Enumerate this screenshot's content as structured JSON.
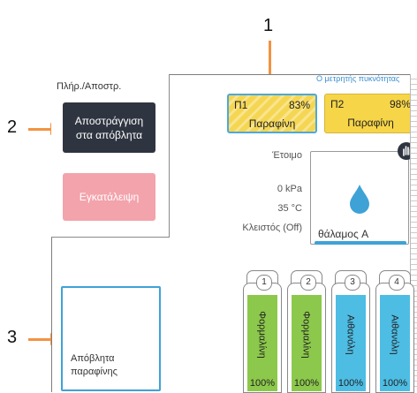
{
  "callouts": {
    "c1": "1",
    "c2": "2",
    "c3": "3"
  },
  "colors": {
    "accent": "#3fa2d6",
    "callout_arrow": "#f39241",
    "paraffin": "#f7d548",
    "alcohol": "#4dbde4",
    "xylene": "#8cc84b",
    "dark_button": "#2f3540",
    "cancel_button": "#f3a3ab"
  },
  "fill_panel": {
    "title": "Πλήρ./Αποστρ.",
    "drain_button": "Αποστράγγιση στα απόβλητα",
    "cancel_button": "Εγκατάλειψη"
  },
  "waste": {
    "label": "Απόβλητα παραφίνης"
  },
  "density_link": "Ο μετρητής πυκνότητας",
  "paraffin_baths": [
    {
      "id": "Π1",
      "percent": "83%",
      "reagent": "Παραφίνη"
    },
    {
      "id": "Π2",
      "percent": "98%",
      "reagent": "Παραφίνη"
    }
  ],
  "status": {
    "state": "Έτοιμο",
    "pressure": "0 kPa",
    "temperature": "35 °C",
    "lid": "Κλειστός (Off)"
  },
  "chamber": {
    "label": "θάλαμος A",
    "icon": "drop-icon"
  },
  "bottles": [
    {
      "num": "1",
      "reagent": "Φορμαλίνη",
      "percent": "100%",
      "color": "#8cc84b"
    },
    {
      "num": "2",
      "reagent": "Φορμαλίνη",
      "percent": "100%",
      "color": "#8cc84b"
    },
    {
      "num": "3",
      "reagent": "Αιθανόλη",
      "percent": "100%",
      "color": "#4dbde4"
    },
    {
      "num": "4",
      "reagent": "Αιθανόλη",
      "percent": "100%",
      "color": "#4dbde4"
    }
  ]
}
